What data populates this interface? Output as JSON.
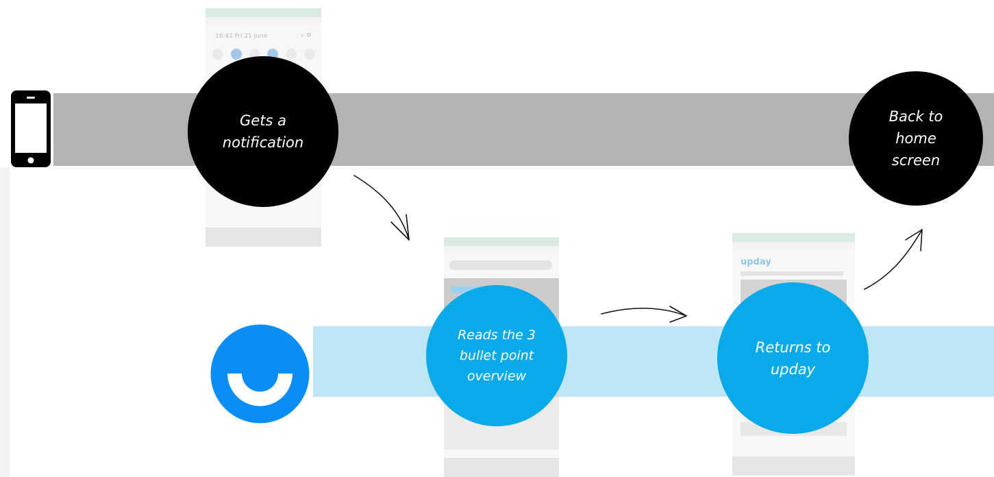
{
  "lanes": [
    {
      "id": "device",
      "icon": "smartphone-icon",
      "color": "#b3b3b3"
    },
    {
      "id": "app",
      "icon": "upday-logo-icon",
      "color": "#bde7f7",
      "icon_color": "#0a8ef5"
    }
  ],
  "steps": [
    {
      "id": "notification",
      "lines": [
        "Gets a",
        "notification"
      ],
      "color": "#000000"
    },
    {
      "id": "reads-overview",
      "lines": [
        "Reads the 3",
        "bullet point",
        "overview"
      ],
      "color": "#0aa9ea"
    },
    {
      "id": "returns",
      "lines": [
        "Returns to",
        "upday"
      ],
      "color": "#0aa9ea"
    },
    {
      "id": "home",
      "lines": [
        "Back to",
        "home",
        "screen"
      ],
      "color": "#000000"
    }
  ],
  "screenshots": {
    "notification_shade": {
      "time_date": "16:41  Fri 21 June"
    },
    "upday_app": {
      "logo": "upday"
    }
  }
}
